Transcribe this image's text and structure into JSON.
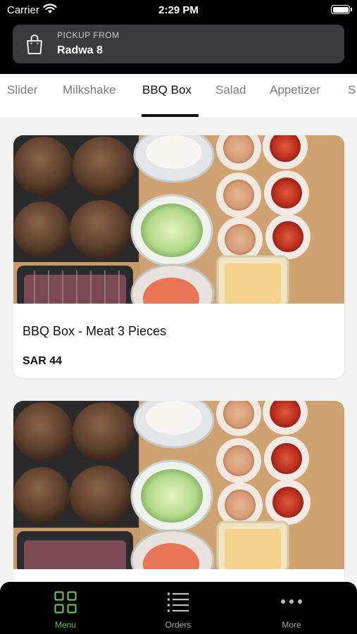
{
  "status_bar": {
    "carrier": "Carrier",
    "time": "2:29 PM"
  },
  "pickup": {
    "label": "PICKUP FROM",
    "location": "Radwa 8",
    "icon": "shopping-bag-icon"
  },
  "categories": {
    "items": [
      "Slider",
      "Milkshake",
      "BBQ Box",
      "Salad",
      "Appetizer",
      "S"
    ],
    "active": "BBQ Box"
  },
  "products": [
    {
      "name": "BBQ Box - Meat 3 Pieces",
      "price": "SAR 44"
    },
    {
      "name": "",
      "price": ""
    }
  ],
  "tab_bar": {
    "items": [
      {
        "label": "Menu",
        "icon": "grid-icon",
        "active": true
      },
      {
        "label": "Orders",
        "icon": "list-icon",
        "active": false
      },
      {
        "label": "More",
        "icon": "more-dots-icon",
        "active": false
      }
    ]
  },
  "colors": {
    "accent": "#67c04a",
    "header_bg": "#000000",
    "pickup_bg": "#3a3a3c"
  }
}
